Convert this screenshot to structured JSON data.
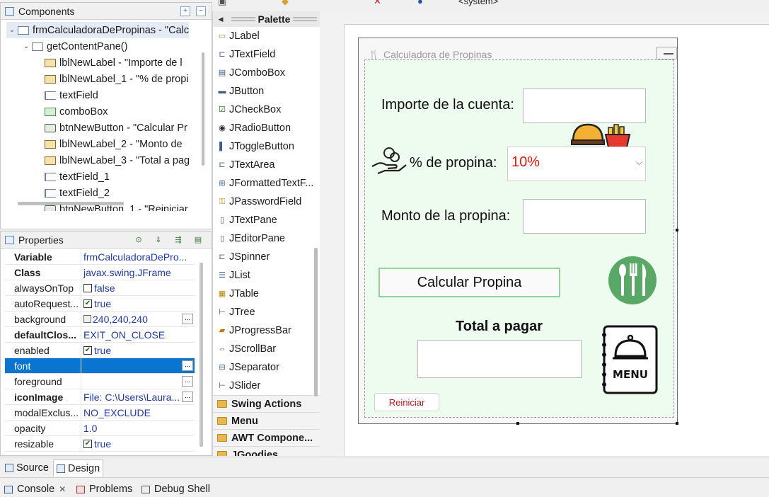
{
  "toolbar": {
    "system_label": "<system>"
  },
  "components": {
    "title": "Components",
    "tree": [
      {
        "label": "frmCalculadoraDePropinas - \"Calc",
        "indent": 0,
        "icon": "frame",
        "twisty": "v"
      },
      {
        "label": "getContentPane()",
        "indent": 1,
        "icon": "frame",
        "twisty": "v"
      },
      {
        "label": "lblNewLabel - \"Importe de l",
        "indent": 2,
        "icon": "label"
      },
      {
        "label": "lblNewLabel_1 - \"% de propi",
        "indent": 2,
        "icon": "label"
      },
      {
        "label": "textField",
        "indent": 2,
        "icon": "field"
      },
      {
        "label": "comboBox",
        "indent": 2,
        "icon": "combo"
      },
      {
        "label": "btnNewButton - \"Calcular Pr",
        "indent": 2,
        "icon": "button"
      },
      {
        "label": "lblNewLabel_2 - \"Monto de",
        "indent": 2,
        "icon": "label"
      },
      {
        "label": "lblNewLabel_3 - \"Total a pag",
        "indent": 2,
        "icon": "label"
      },
      {
        "label": "textField_1",
        "indent": 2,
        "icon": "field"
      },
      {
        "label": "textField_2",
        "indent": 2,
        "icon": "field"
      },
      {
        "label": "btnNewButton_1 - \"Reiniciar",
        "indent": 2,
        "icon": "button"
      }
    ]
  },
  "properties": {
    "title": "Properties",
    "rows": [
      {
        "name": "Variable",
        "value": "frmCalculadoraDePro...",
        "bold": true
      },
      {
        "name": "Class",
        "value": "javax.swing.JFrame",
        "bold": true
      },
      {
        "name": "alwaysOnTop",
        "value": "false",
        "check": "unchecked"
      },
      {
        "name": "autoRequest...",
        "value": "true",
        "check": "checked"
      },
      {
        "name": "background",
        "value": "240,240,240",
        "swatch": true,
        "dots": true
      },
      {
        "name": "defaultClos...",
        "value": "EXIT_ON_CLOSE",
        "bold": true
      },
      {
        "name": "enabled",
        "value": "true",
        "check": "checked"
      },
      {
        "name": "font",
        "value": "",
        "selected": true,
        "dots": true
      },
      {
        "name": "foreground",
        "value": "",
        "dots": true
      },
      {
        "name": "iconImage",
        "value": "File: C:\\Users\\Laura...",
        "bold": true,
        "dots": true
      },
      {
        "name": "modalExclus...",
        "value": "NO_EXCLUDE"
      },
      {
        "name": "opacity",
        "value": "1.0"
      },
      {
        "name": "resizable",
        "value": "true",
        "check": "checked"
      }
    ]
  },
  "palette": {
    "title": "Palette",
    "items": [
      {
        "label": "JLabel",
        "icon": "label"
      },
      {
        "label": "JTextField",
        "icon": "textfield"
      },
      {
        "label": "JComboBox",
        "icon": "combo"
      },
      {
        "label": "JButton",
        "icon": "button"
      },
      {
        "label": "JCheckBox",
        "icon": "checkbox"
      },
      {
        "label": "JRadioButton",
        "icon": "radio"
      },
      {
        "label": "JToggleButton",
        "icon": "toggle"
      },
      {
        "label": "JTextArea",
        "icon": "textarea"
      },
      {
        "label": "JFormattedTextF...",
        "icon": "formatted"
      },
      {
        "label": "JPasswordField",
        "icon": "password"
      },
      {
        "label": "JTextPane",
        "icon": "textpane"
      },
      {
        "label": "JEditorPane",
        "icon": "editorpane"
      },
      {
        "label": "JSpinner",
        "icon": "spinner"
      },
      {
        "label": "JList",
        "icon": "list"
      },
      {
        "label": "JTable",
        "icon": "table"
      },
      {
        "label": "JTree",
        "icon": "tree"
      },
      {
        "label": "JProgressBar",
        "icon": "progress"
      },
      {
        "label": "JScrollBar",
        "icon": "scrollbar"
      },
      {
        "label": "JSeparator",
        "icon": "separator"
      },
      {
        "label": "JSlider",
        "icon": "slider"
      }
    ],
    "categories": [
      "Swing Actions",
      "Menu",
      "AWT Compone...",
      "JGoodies"
    ]
  },
  "form": {
    "window_title": "Calculadora de Propinas",
    "lbl_importe": "Importe de la cuenta:",
    "lbl_propina_pct": "% de propina:",
    "combo_value": "10%",
    "lbl_monto": "Monto de la propina:",
    "btn_calcular": "Calcular Propina",
    "lbl_total": "Total a pagar",
    "btn_reiniciar": "Reiniciar",
    "menu_icon_text": "MENU",
    "colors": {
      "content_bg": "#eefbef",
      "combo_text": "#e8130d",
      "button_border": "#90d49a",
      "reset_text": "#c0181e",
      "cutlery_circle": "#5aa867"
    }
  },
  "editor_tabs": {
    "source": "Source",
    "design": "Design"
  },
  "bottom_tabs": {
    "console": "Console",
    "problems": "Problems",
    "debug_shell": "Debug Shell"
  }
}
